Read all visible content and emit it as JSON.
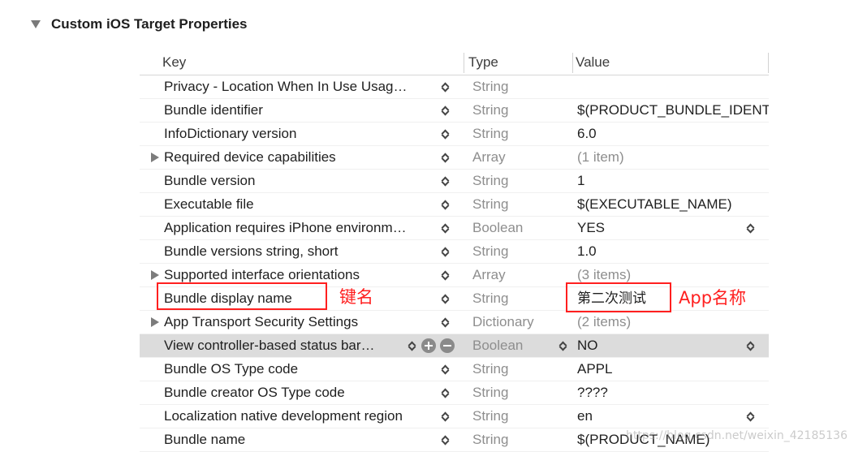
{
  "section": {
    "title": "Custom iOS Target Properties"
  },
  "table": {
    "columns": {
      "key": "Key",
      "type": "Type",
      "value": "Value"
    },
    "rows": [
      {
        "key": "Privacy - Location When In Use Usag…",
        "type": "String"
      },
      {
        "key": "Bundle identifier",
        "type": "String",
        "value": "$(PRODUCT_BUNDLE_IDENT"
      },
      {
        "key": "InfoDictionary version",
        "type": "String",
        "value": "6.0"
      },
      {
        "key": "Required device capabilities",
        "type": "Array",
        "value": "(1 item)",
        "expandable": true
      },
      {
        "key": "Bundle version",
        "type": "String",
        "value": "1"
      },
      {
        "key": "Executable file",
        "type": "String",
        "value": "$(EXECUTABLE_NAME)"
      },
      {
        "key": "Application requires iPhone environm…",
        "type": "Boolean",
        "value": "YES"
      },
      {
        "key": "Bundle versions string, short",
        "type": "String",
        "value": "1.0"
      },
      {
        "key": "Supported interface orientations",
        "type": "Array",
        "value": "(3 items)",
        "expandable": true
      },
      {
        "key": "Bundle display name",
        "type": "String",
        "value": "第二次测试"
      },
      {
        "key": "App Transport Security Settings",
        "type": "Dictionary",
        "value": "(2 items)",
        "expandable": true
      },
      {
        "key": "View controller-based status bar…",
        "type": "Boolean",
        "value": "NO",
        "selected": true
      },
      {
        "key": "Bundle OS Type code",
        "type": "String",
        "value": "APPL"
      },
      {
        "key": "Bundle creator OS Type code",
        "type": "String",
        "value": "????"
      },
      {
        "key": "Localization native development region",
        "type": "String",
        "value": "en"
      },
      {
        "key": "Bundle name",
        "type": "String",
        "value": "$(PRODUCT_NAME)"
      }
    ]
  },
  "annotations": {
    "key_label": "键名",
    "value_label": "App名称"
  },
  "watermark": "https://blog.csdn.net/weixin_42185136",
  "colors": {
    "annotation": "#ff1f1f",
    "selected_row": "#dcdcdc",
    "muted_text": "#8e8e8e"
  },
  "icons": {
    "section_toggle": "disclosure-down-icon",
    "row_expand": "disclosure-right-icon",
    "row_stepper": "up-down-chevron-icon",
    "add_row": "plus-circle-icon",
    "remove_row": "minus-circle-icon"
  }
}
